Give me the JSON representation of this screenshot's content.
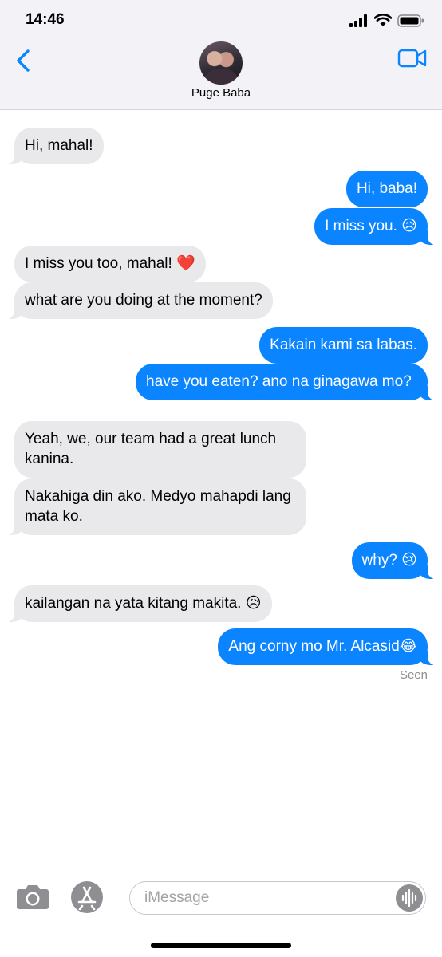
{
  "status_bar": {
    "time": "14:46",
    "icons": [
      "cellular-signal-icon",
      "wifi-icon",
      "battery-icon"
    ]
  },
  "header": {
    "contact_name": "Puge Baba",
    "back_icon": "chevron-left-icon",
    "video_icon": "video-camera-icon",
    "accent_color": "#0a84ff"
  },
  "messages": [
    {
      "dir": "in",
      "text": "Hi, mahal!"
    },
    {
      "dir": "out",
      "text": "Hi, baba!"
    },
    {
      "dir": "out",
      "text": "I miss you. 😥"
    },
    {
      "dir": "in",
      "text": "I miss you too, mahal! ❤️"
    },
    {
      "dir": "in",
      "text": "what are you doing at the moment?"
    },
    {
      "dir": "out",
      "text": "Kakain kami sa labas."
    },
    {
      "dir": "out",
      "text": "have you eaten? ano na ginagawa mo?"
    },
    {
      "dir": "in",
      "text": "Yeah, we, our team had a great lunch kanina."
    },
    {
      "dir": "in",
      "text": "Nakahiga din ako. Medyo mahapdi lang mata ko."
    },
    {
      "dir": "out",
      "text": "why? 😢"
    },
    {
      "dir": "in",
      "text": "kailangan na yata kitang makita. 😥"
    },
    {
      "dir": "out",
      "text": "Ang corny mo Mr. Alcasid😂"
    }
  ],
  "seen_label": "Seen",
  "input_bar": {
    "placeholder": "iMessage",
    "value": "",
    "icons": [
      "camera-icon",
      "app-store-icon",
      "audio-waveform-icon"
    ]
  },
  "colors": {
    "outgoing_bubble": "#0a84ff",
    "incoming_bubble": "#e9e9eb",
    "header_background": "#f2f2f7"
  }
}
